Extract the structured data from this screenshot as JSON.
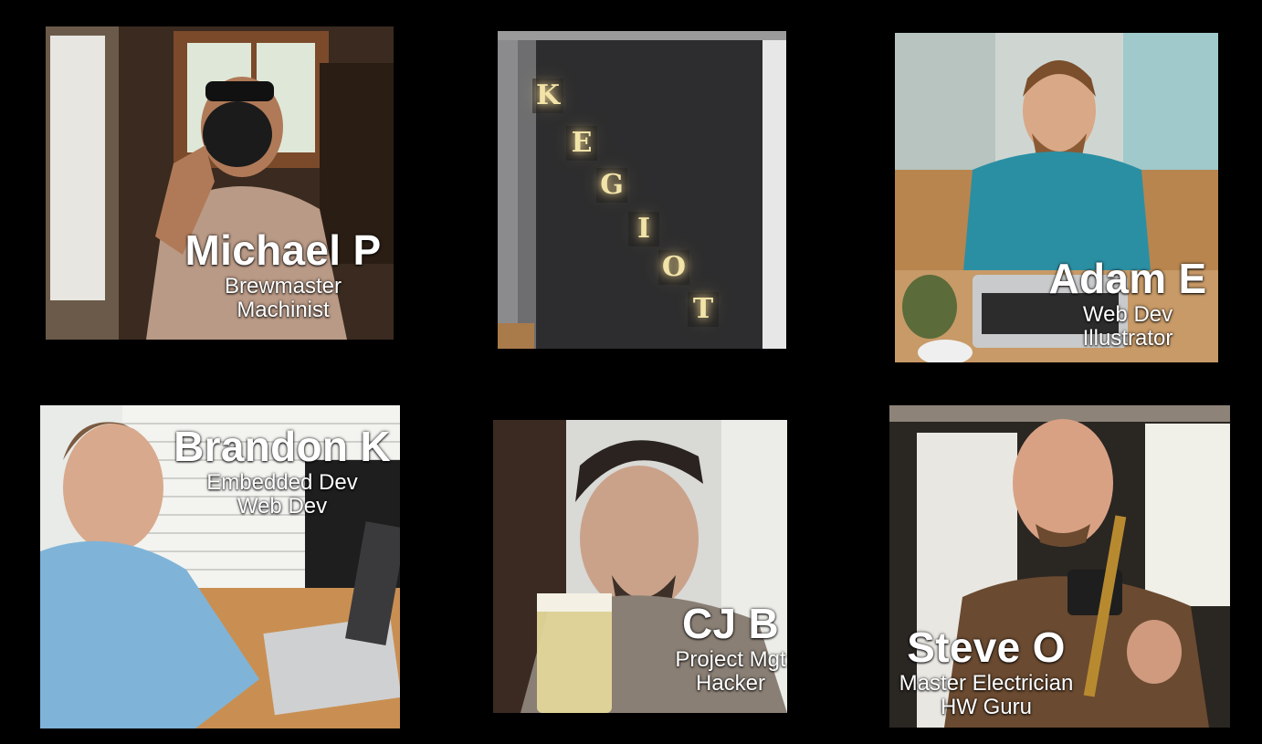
{
  "team": [
    {
      "id": "michael",
      "name": "Michael P",
      "roles": [
        "Brewmaster",
        "Machinist"
      ]
    },
    {
      "id": "kegiot",
      "logo_letters": [
        "K",
        "E",
        "G",
        "I",
        "O",
        "T"
      ]
    },
    {
      "id": "adam",
      "name": "Adam E",
      "roles": [
        "Web Dev",
        "Illustrator"
      ]
    },
    {
      "id": "brandon",
      "name": "Brandon K",
      "roles": [
        "Embedded Dev",
        "Web Dev"
      ]
    },
    {
      "id": "cj",
      "name": "CJ B",
      "roles": [
        "Project Mgt",
        "Hacker"
      ]
    },
    {
      "id": "steve",
      "name": "Steve O",
      "roles": [
        "Master Electrician",
        "HW Guru"
      ]
    }
  ],
  "colors": {
    "background": "#000000",
    "caption_text": "#ffffff",
    "logo_glow": "#f2e3a8"
  }
}
